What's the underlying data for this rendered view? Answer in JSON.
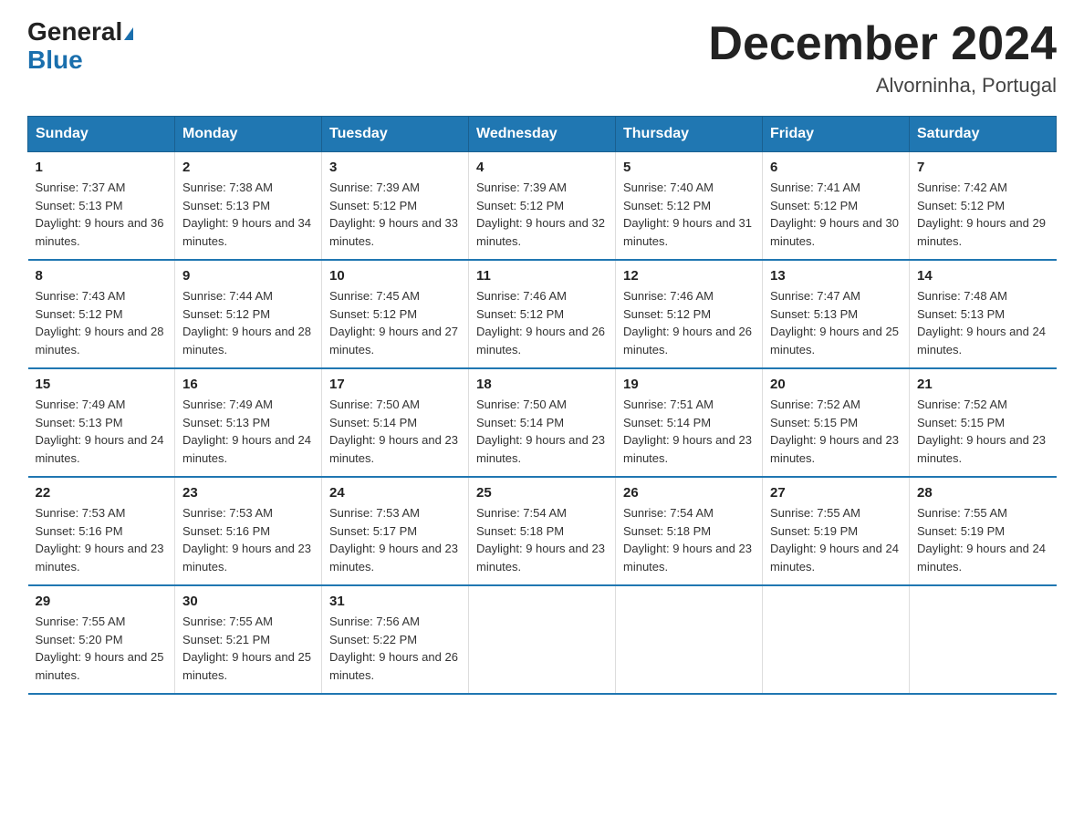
{
  "header": {
    "logo_general": "General",
    "logo_blue": "Blue",
    "month_title": "December 2024",
    "location": "Alvorninha, Portugal"
  },
  "days_of_week": [
    "Sunday",
    "Monday",
    "Tuesday",
    "Wednesday",
    "Thursday",
    "Friday",
    "Saturday"
  ],
  "weeks": [
    [
      {
        "num": "1",
        "sunrise": "7:37 AM",
        "sunset": "5:13 PM",
        "daylight": "9 hours and 36 minutes."
      },
      {
        "num": "2",
        "sunrise": "7:38 AM",
        "sunset": "5:13 PM",
        "daylight": "9 hours and 34 minutes."
      },
      {
        "num": "3",
        "sunrise": "7:39 AM",
        "sunset": "5:12 PM",
        "daylight": "9 hours and 33 minutes."
      },
      {
        "num": "4",
        "sunrise": "7:39 AM",
        "sunset": "5:12 PM",
        "daylight": "9 hours and 32 minutes."
      },
      {
        "num": "5",
        "sunrise": "7:40 AM",
        "sunset": "5:12 PM",
        "daylight": "9 hours and 31 minutes."
      },
      {
        "num": "6",
        "sunrise": "7:41 AM",
        "sunset": "5:12 PM",
        "daylight": "9 hours and 30 minutes."
      },
      {
        "num": "7",
        "sunrise": "7:42 AM",
        "sunset": "5:12 PM",
        "daylight": "9 hours and 29 minutes."
      }
    ],
    [
      {
        "num": "8",
        "sunrise": "7:43 AM",
        "sunset": "5:12 PM",
        "daylight": "9 hours and 28 minutes."
      },
      {
        "num": "9",
        "sunrise": "7:44 AM",
        "sunset": "5:12 PM",
        "daylight": "9 hours and 28 minutes."
      },
      {
        "num": "10",
        "sunrise": "7:45 AM",
        "sunset": "5:12 PM",
        "daylight": "9 hours and 27 minutes."
      },
      {
        "num": "11",
        "sunrise": "7:46 AM",
        "sunset": "5:12 PM",
        "daylight": "9 hours and 26 minutes."
      },
      {
        "num": "12",
        "sunrise": "7:46 AM",
        "sunset": "5:12 PM",
        "daylight": "9 hours and 26 minutes."
      },
      {
        "num": "13",
        "sunrise": "7:47 AM",
        "sunset": "5:13 PM",
        "daylight": "9 hours and 25 minutes."
      },
      {
        "num": "14",
        "sunrise": "7:48 AM",
        "sunset": "5:13 PM",
        "daylight": "9 hours and 24 minutes."
      }
    ],
    [
      {
        "num": "15",
        "sunrise": "7:49 AM",
        "sunset": "5:13 PM",
        "daylight": "9 hours and 24 minutes."
      },
      {
        "num": "16",
        "sunrise": "7:49 AM",
        "sunset": "5:13 PM",
        "daylight": "9 hours and 24 minutes."
      },
      {
        "num": "17",
        "sunrise": "7:50 AM",
        "sunset": "5:14 PM",
        "daylight": "9 hours and 23 minutes."
      },
      {
        "num": "18",
        "sunrise": "7:50 AM",
        "sunset": "5:14 PM",
        "daylight": "9 hours and 23 minutes."
      },
      {
        "num": "19",
        "sunrise": "7:51 AM",
        "sunset": "5:14 PM",
        "daylight": "9 hours and 23 minutes."
      },
      {
        "num": "20",
        "sunrise": "7:52 AM",
        "sunset": "5:15 PM",
        "daylight": "9 hours and 23 minutes."
      },
      {
        "num": "21",
        "sunrise": "7:52 AM",
        "sunset": "5:15 PM",
        "daylight": "9 hours and 23 minutes."
      }
    ],
    [
      {
        "num": "22",
        "sunrise": "7:53 AM",
        "sunset": "5:16 PM",
        "daylight": "9 hours and 23 minutes."
      },
      {
        "num": "23",
        "sunrise": "7:53 AM",
        "sunset": "5:16 PM",
        "daylight": "9 hours and 23 minutes."
      },
      {
        "num": "24",
        "sunrise": "7:53 AM",
        "sunset": "5:17 PM",
        "daylight": "9 hours and 23 minutes."
      },
      {
        "num": "25",
        "sunrise": "7:54 AM",
        "sunset": "5:18 PM",
        "daylight": "9 hours and 23 minutes."
      },
      {
        "num": "26",
        "sunrise": "7:54 AM",
        "sunset": "5:18 PM",
        "daylight": "9 hours and 23 minutes."
      },
      {
        "num": "27",
        "sunrise": "7:55 AM",
        "sunset": "5:19 PM",
        "daylight": "9 hours and 24 minutes."
      },
      {
        "num": "28",
        "sunrise": "7:55 AM",
        "sunset": "5:19 PM",
        "daylight": "9 hours and 24 minutes."
      }
    ],
    [
      {
        "num": "29",
        "sunrise": "7:55 AM",
        "sunset": "5:20 PM",
        "daylight": "9 hours and 25 minutes."
      },
      {
        "num": "30",
        "sunrise": "7:55 AM",
        "sunset": "5:21 PM",
        "daylight": "9 hours and 25 minutes."
      },
      {
        "num": "31",
        "sunrise": "7:56 AM",
        "sunset": "5:22 PM",
        "daylight": "9 hours and 26 minutes."
      },
      null,
      null,
      null,
      null
    ]
  ]
}
